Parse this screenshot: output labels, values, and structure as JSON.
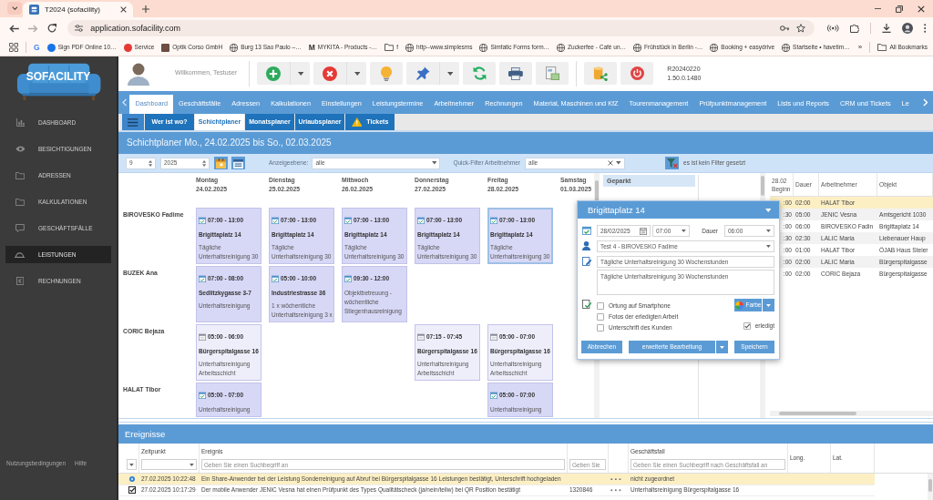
{
  "browser": {
    "tab_title": "T2024 (sofacility)",
    "url": "application.sofacility.com",
    "forward_disabled": true,
    "bookmarks": [
      {
        "kind": "glyph",
        "glyph": "G",
        "color": "#4285f4"
      },
      {
        "kind": "dot",
        "color": "#1a73e8",
        "label": "Sign PDF Online 10…"
      },
      {
        "kind": "dot",
        "color": "#e53935",
        "label": "Service"
      },
      {
        "kind": "square",
        "color": "#6d4c41",
        "label": "Optik Corso GmbH"
      },
      {
        "kind": "globe",
        "label": "Burg 13 Sao Paulo –…"
      },
      {
        "kind": "glyph",
        "glyph": "M",
        "color": "#333333",
        "label": "MYKITA - Products -…"
      },
      {
        "kind": "folder",
        "label": "f"
      },
      {
        "kind": "globe",
        "label": "http--www.simplesms"
      },
      {
        "kind": "globe",
        "label": "Simfatic Forms form…"
      },
      {
        "kind": "globe",
        "label": "Zuckerfee - Café un…"
      },
      {
        "kind": "globe",
        "label": "Frühstück in Berlin -…"
      },
      {
        "kind": "globe",
        "label": "Booking + easydrive"
      },
      {
        "kind": "globe",
        "label": "Startseite • havetim…"
      }
    ],
    "overflow": "»",
    "all_bookmarks": "All Bookmarks"
  },
  "sidebar": {
    "logo": "SOFACILITY",
    "items": [
      {
        "kind": "chart",
        "label": "DASHBOARD",
        "selected": false
      },
      {
        "kind": "eye",
        "label": "BESICHTIGUNGEN",
        "selected": false
      },
      {
        "kind": "folder",
        "label": "ADRESSEN",
        "selected": false
      },
      {
        "kind": "folder",
        "label": "KALKULATIONEN",
        "selected": false
      },
      {
        "kind": "chat",
        "label": "GESCHÄFTSFÄLLE",
        "selected": false
      },
      {
        "kind": "dome",
        "label": "LEISTUNGEN",
        "selected": true
      },
      {
        "kind": "invoice",
        "label": "RECHNUNGEN",
        "selected": false
      }
    ],
    "footer": [
      "Nutzungsbedingungen",
      "Hilfe"
    ]
  },
  "header": {
    "welcome": "Willkommen, Testuser",
    "toolbar": [
      {
        "buttons": [
          {
            "kind": "add",
            "dropdown": true
          },
          {
            "kind": "delete",
            "dropdown": true
          },
          {
            "kind": "bulb",
            "dropdown": false
          },
          {
            "kind": "pin",
            "dropdown": true
          },
          {
            "kind": "refresh",
            "dropdown": false
          },
          {
            "kind": "print",
            "dropdown": false
          },
          {
            "kind": "picture",
            "dropdown": false
          }
        ]
      },
      {
        "buttons": [
          {
            "kind": "share",
            "dropdown": false
          },
          {
            "kind": "power",
            "dropdown": false
          }
        ]
      }
    ],
    "version": [
      "R20240220",
      "1.50.0.1480"
    ]
  },
  "modules": {
    "tabs": [
      {
        "label": "Dashboard",
        "selected": true
      },
      {
        "label": "Geschäftsfälle",
        "selected": false
      },
      {
        "label": "Adressen",
        "selected": false
      },
      {
        "label": "Kalkulationen",
        "selected": false
      },
      {
        "label": "Einstellungen",
        "selected": false
      },
      {
        "label": "Leistungstermine",
        "selected": false
      },
      {
        "label": "Arbeitnehmer",
        "selected": false
      },
      {
        "label": "Rechnungen",
        "selected": false
      },
      {
        "label": "Material, Maschinen und KfZ",
        "selected": false
      },
      {
        "label": "Tourenmanagement",
        "selected": false
      },
      {
        "label": "Prüfpunktmanagement",
        "selected": false
      },
      {
        "label": "Lists und Reports",
        "selected": false
      },
      {
        "label": "CRM und Tickets",
        "selected": false
      },
      {
        "label": "Le",
        "selected": false
      }
    ]
  },
  "subnav": {
    "tabs": [
      {
        "kind": "plain",
        "label": "Wer ist wo?",
        "selected": false
      },
      {
        "kind": "plain",
        "label": "Schichtplaner",
        "selected": true
      },
      {
        "kind": "plain",
        "label": "Monatsplaner",
        "selected": false
      },
      {
        "kind": "plain",
        "label": "Urlaubsplaner",
        "selected": false
      },
      {
        "kind": "warning",
        "label": "Tickets",
        "selected": false
      }
    ]
  },
  "planner": {
    "title": "Schichtplaner Mo., 24.02.2025 bis So., 02.03.2025",
    "filters": {
      "week": "9",
      "year": "2025",
      "level_label": "Anzeigeebene:",
      "level_value": "alle",
      "employee_label": "Quick-Filter Arbeitnehmer",
      "employee_value": "alle",
      "filter_status": "es ist kein Filter gesetzt"
    },
    "days": [
      {
        "name": "Montag",
        "date": "24.02.2025"
      },
      {
        "name": "Dienstag",
        "date": "25.02.2025"
      },
      {
        "name": "Mittwoch",
        "date": "26.02.2025"
      },
      {
        "name": "Donnerstag",
        "date": "27.02.2025"
      },
      {
        "name": "Freitag",
        "date": "28.02.2025"
      },
      {
        "name": "Samstag",
        "date": "01.03.2025"
      }
    ],
    "employees": [
      {
        "name": "BIROVESKO Fadime",
        "shifts": [
          {
            "kind": "shift",
            "time": "07:00 - 13:00",
            "place": "Brigittaplatz 14",
            "note": "Tägliche Unterhaltsreinigung 30",
            "color": "#d7d7f6",
            "confirmed": true,
            "selected": false
          },
          {
            "kind": "shift",
            "time": "07:00 - 13:00",
            "place": "Brigittaplatz 14",
            "note": "Tägliche Unterhaltsreinigung 30",
            "color": "#d7d7f6",
            "confirmed": true,
            "selected": false
          },
          {
            "kind": "shift",
            "time": "07:00 - 13:00",
            "place": "Brigittaplatz 14",
            "note": "Tägliche Unterhaltsreinigung 30",
            "color": "#d7d7f6",
            "confirmed": true,
            "selected": false
          },
          {
            "kind": "shift",
            "time": "07:00 - 13:00",
            "place": "Brigittaplatz 14",
            "note": "Tägliche Unterhaltsreinigung 30",
            "color": "#d7d7f6",
            "confirmed": true,
            "selected": false
          },
          {
            "kind": "shift",
            "time": "07:00 - 13:00",
            "place": "Brigittaplatz 14",
            "note": "Tägliche Unterhaltsreinigung 30",
            "color": "#d7d7f6",
            "confirmed": true,
            "selected": true
          },
          {
            "kind": "free"
          }
        ]
      },
      {
        "name": "BUZEK Ana",
        "shifts": [
          {
            "kind": "shift",
            "time": "07:00 - 08:00",
            "place": "Sedlitzkygasse 3-7",
            "note": "Unterhaltsreinigung",
            "color": "#d7d7f6",
            "confirmed": true,
            "selected": false
          },
          {
            "kind": "shift",
            "time": "05:00 - 10:00",
            "place": "Industriestrasse 36",
            "note": "1 x wöchentliche Unterhaltsreinigung 3 x",
            "color": "#d7d7f6",
            "confirmed": true,
            "selected": false
          },
          {
            "kind": "shift",
            "time": "09:30 - 12:00",
            "note": "Objektbetreuung - wöchentliche Stiegenhausreinigung",
            "color": "#d7d7f6",
            "confirmed": true,
            "selected": false
          },
          {
            "kind": "free"
          },
          {
            "kind": "free"
          },
          {
            "kind": "free"
          }
        ]
      },
      {
        "name": "CORIC Bejaza",
        "shifts": [
          {
            "kind": "shift",
            "time": "05:00 - 06:00",
            "place": "Bürgerspitalgasse 16",
            "note": "Unterhaltsreinigung Arbeitsschicht",
            "color": "#eeeefb",
            "confirmed": false,
            "selected": false
          },
          {
            "kind": "free"
          },
          {
            "kind": "free"
          },
          {
            "kind": "shift",
            "time": "07:15 - 07:45",
            "place": "Bürgerspitalgasse 16",
            "note": "Unterhaltsreinigung Arbeitsschicht",
            "color": "#eeeefb",
            "confirmed": false,
            "selected": false
          },
          {
            "kind": "shift",
            "time": "05:00 - 07:00",
            "place": "Bürgerspitalgasse 16",
            "note": "Unterhaltsreinigung Arbeitsschicht",
            "color": "#eeeefb",
            "confirmed": false,
            "selected": false
          },
          {
            "kind": "free"
          }
        ]
      },
      {
        "name": "HALAT Tibor",
        "shifts": [
          {
            "kind": "shift",
            "time": "05:00 - 07:00",
            "note": "Unterhaltsreinigung",
            "color": "#d7d7f6",
            "confirmed": true,
            "selected": false
          },
          {
            "kind": "free"
          },
          {
            "kind": "free"
          },
          {
            "kind": "free"
          },
          {
            "kind": "shift",
            "time": "05:00 - 07:00",
            "note": "Unterhaltsreinigung",
            "color": "#d7d7f6",
            "confirmed": true,
            "selected": false
          },
          {
            "kind": "free"
          }
        ]
      }
    ],
    "parked": {
      "title": "Geparkt"
    },
    "shift_list": {
      "columns": [
        {
          "date": "28.02",
          "label": "Beginn"
        },
        {
          "label": "Dauer"
        },
        {
          "label": "Arbeitnehmer"
        },
        {
          "label": "Objekt"
        }
      ],
      "rows": [
        {
          "start": ":00",
          "duration": "02:00",
          "employee": "HALAT Tibor",
          "selected": true
        },
        {
          "start": ":30",
          "duration": "05:00",
          "employee": "JENIC Vesna",
          "object": "Amtsgericht 1030",
          "selected": false
        },
        {
          "start": ":00",
          "duration": "06:00",
          "employee": "BIROVESKO Fadin",
          "object": "Brigittaplatz 14",
          "selected": false
        },
        {
          "start": ":30",
          "duration": "02:30",
          "employee": "LALIC Maria",
          "object": "Liebenauer Haup",
          "selected": false
        },
        {
          "start": ":00",
          "duration": "01:00",
          "employee": "HALAT Tibor",
          "object": "ÖJAB Haus Steier",
          "selected": false
        },
        {
          "start": ":00",
          "duration": "02:00",
          "employee": "LALIC Maria",
          "object": "Bürgerspitalgasse",
          "selected": false
        },
        {
          "start": ":00",
          "duration": "02:00",
          "employee": "CORIC Bejaza",
          "object": "Bürgerspitalgasse",
          "selected": false
        }
      ]
    },
    "dialog": {
      "title": "Brigittaplatz 14",
      "date": "28/02/2025",
      "time": "07:00",
      "duration_label": "Dauer",
      "duration": "06:00",
      "employee": "Test 4 - BIROVESKO Fadime",
      "subject": "Tägliche Unterhaltsreinigung 30 Wochenstunden",
      "description": "Tägliche Unterhaltsreinigung 30 Wochenstunden",
      "color_button": "Farbe",
      "options": [
        {
          "label": "Ortung auf Smartphone",
          "checked": false
        },
        {
          "label": "Fotos der erledigten Arbeit",
          "checked": false
        },
        {
          "label": "Unterschrift des Kunden",
          "checked": false
        }
      ],
      "done": {
        "label": "erledigt",
        "checked": true
      },
      "buttons": {
        "cancel": "Abbrechen",
        "extended": "erweiterte Bearbeitung",
        "save": "Speichern"
      }
    }
  },
  "events": {
    "title": "Ereignisse",
    "columns": [
      {
        "kind": "select"
      },
      {
        "kind": "select",
        "label": "Zeitpunkt"
      },
      {
        "kind": "text",
        "label": "Ereignis",
        "placeholder": "Geben Sie einen Suchbegriff an"
      },
      {
        "kind": "text",
        "placeholder": "Geben Sie"
      },
      {
        "kind": "blank"
      },
      {
        "kind": "text",
        "label": "Geschäftsfall",
        "placeholder": "Geben Sie einen Suchbegriff nach Geschäftsfall an"
      },
      {
        "kind": "blank",
        "label": "Long."
      },
      {
        "kind": "blank",
        "label": "Lat."
      }
    ],
    "rows": [
      {
        "kind": "info",
        "time": "27.02.2025 10:22:48",
        "text": "Ein Share-Anwender bei der Leistung Sonderreinigung auf Abruf bei Bürgerspitalgasse 16 Leistungen bestätigt, Unterschrift hochgeladen",
        "case": "nicht zugeordnet",
        "selected": true
      },
      {
        "kind": "check",
        "time": "27.02.2025 10:17:29",
        "text": "Der mobile Anwender JENIC Vesna hat einen Prüfpunkt des Types Qualitätscheck (ja/nein/teilw) bei QR Position bestätigt",
        "number": "1320846",
        "case": "Unterhaltsreinigung Bürgerspitalgasse 16",
        "selected": false
      }
    ]
  }
}
